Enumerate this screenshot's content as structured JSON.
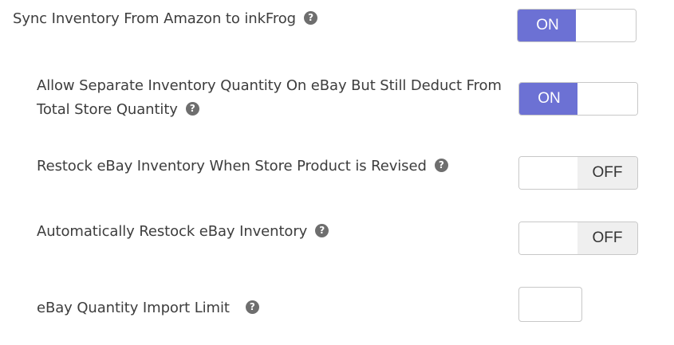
{
  "settings": {
    "sync_inventory": {
      "label": "Sync Inventory From Amazon to inkFrog",
      "help_icon": "question-circle-icon",
      "state_text": "ON"
    },
    "separate_quantity": {
      "label_line1": "Allow Separate Inventory Quantity On eBay But Still Deduct From",
      "label_line2": "Total Store Quantity",
      "help_icon": "question-circle-icon",
      "state_text": "ON"
    },
    "restock_on_revise": {
      "label": "Restock eBay Inventory When Store Product is Revised",
      "help_icon": "question-circle-icon",
      "state_text": "OFF"
    },
    "auto_restock": {
      "label": "Automatically Restock eBay Inventory",
      "help_icon": "question-circle-icon",
      "state_text": "OFF"
    },
    "quantity_import_limit": {
      "label": "eBay Quantity Import Limit",
      "help_icon": "question-circle-icon",
      "value": ""
    }
  },
  "colors": {
    "toggle_on": "#6c71d4",
    "toggle_off_segment": "#efefef",
    "help_icon": "#6e6e6e"
  }
}
